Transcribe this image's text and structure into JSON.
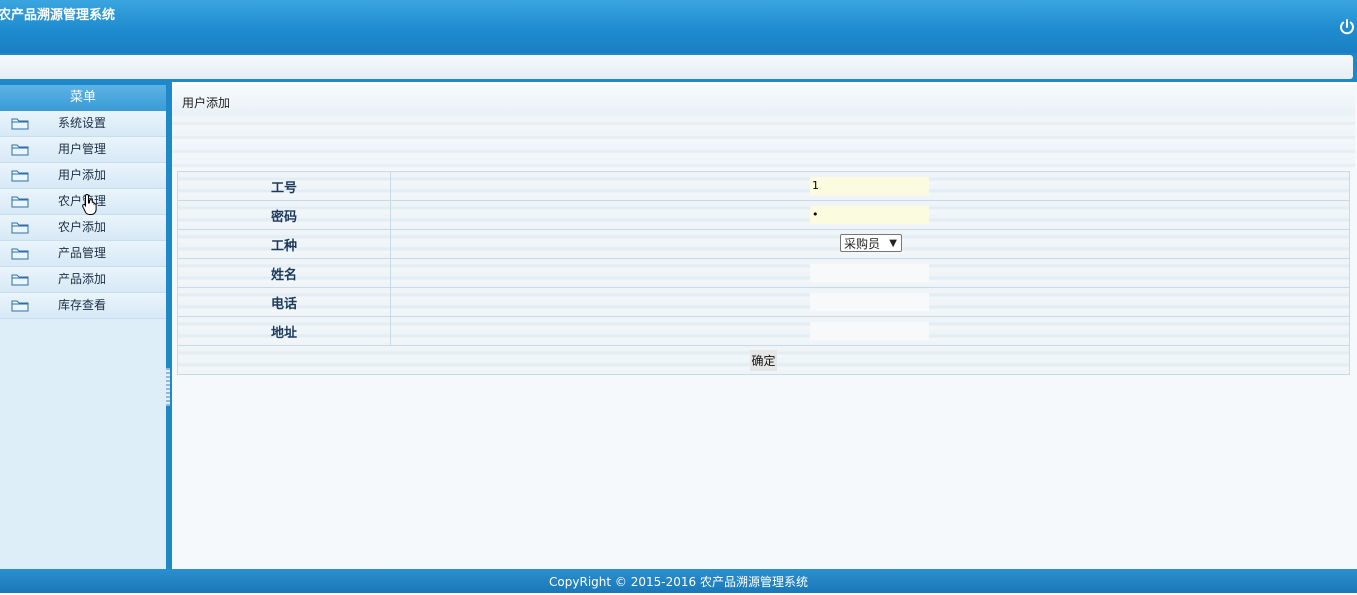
{
  "header": {
    "title": "农产品溯源管理系统",
    "power_icon": "power-icon"
  },
  "sidebar": {
    "title": "菜单",
    "items": [
      {
        "label": "系统设置",
        "icon": "folder-icon"
      },
      {
        "label": "用户管理",
        "icon": "folder-icon"
      },
      {
        "label": "用户添加",
        "icon": "folder-icon"
      },
      {
        "label": "农户管理",
        "icon": "folder-icon"
      },
      {
        "label": "农户添加",
        "icon": "folder-icon"
      },
      {
        "label": "产品管理",
        "icon": "folder-icon"
      },
      {
        "label": "产品添加",
        "icon": "folder-icon"
      },
      {
        "label": "库存查看",
        "icon": "folder-icon"
      }
    ]
  },
  "main": {
    "title": "用户添加",
    "form": {
      "fields": [
        {
          "label": "工号",
          "value": "1"
        },
        {
          "label": "密码",
          "value": "•"
        },
        {
          "label": "工种",
          "value": "采购员"
        },
        {
          "label": "姓名",
          "value": ""
        },
        {
          "label": "电话",
          "value": ""
        },
        {
          "label": "地址",
          "value": ""
        }
      ],
      "submit_label": "确定"
    }
  },
  "footer": {
    "text": "CopyRight © 2015-2016 农产品溯源管理系统"
  },
  "colors": {
    "header": "#1f8ccf",
    "sidebar_bg": "#deeef9",
    "input_highlight": "#fbfbe0"
  }
}
